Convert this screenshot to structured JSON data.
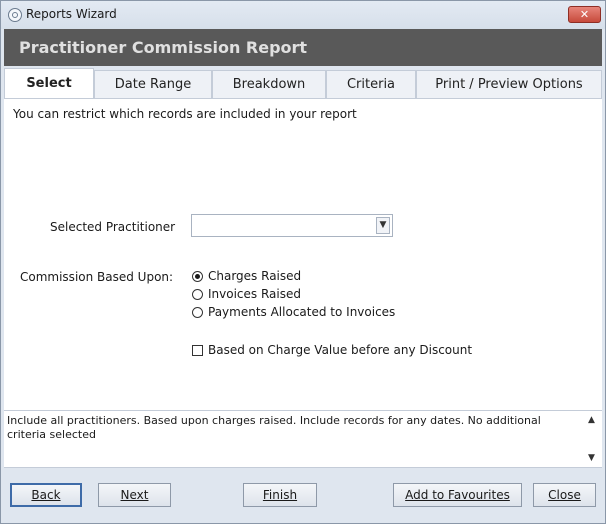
{
  "window": {
    "title": "Reports Wizard",
    "close_label": "✕"
  },
  "header": {
    "title": "Practitioner Commission Report"
  },
  "tabs": [
    {
      "label": "Select"
    },
    {
      "label": "Date Range"
    },
    {
      "label": "Breakdown"
    },
    {
      "label": "Criteria"
    },
    {
      "label": "Print / Preview Options"
    }
  ],
  "select_tab": {
    "intro": "You can restrict which records are included in your report",
    "practitioner_label": "Selected Practitioner",
    "practitioner_value": "",
    "commission_label": "Commission Based Upon:",
    "options": [
      {
        "label": "Charges Raised",
        "checked": true
      },
      {
        "label": "Invoices Raised",
        "checked": false
      },
      {
        "label": "Payments Allocated to Invoices",
        "checked": false
      }
    ],
    "discount_checkbox_label": "Based on Charge Value before any Discount",
    "discount_checked": false
  },
  "summary": {
    "text": "Include all practitioners. Based upon charges raised. Include records for any dates. No additional criteria selected"
  },
  "buttons": {
    "back": "Back",
    "next": "Next",
    "finish": "Finish",
    "favourites": "Add to Favourites",
    "close": "Close"
  }
}
